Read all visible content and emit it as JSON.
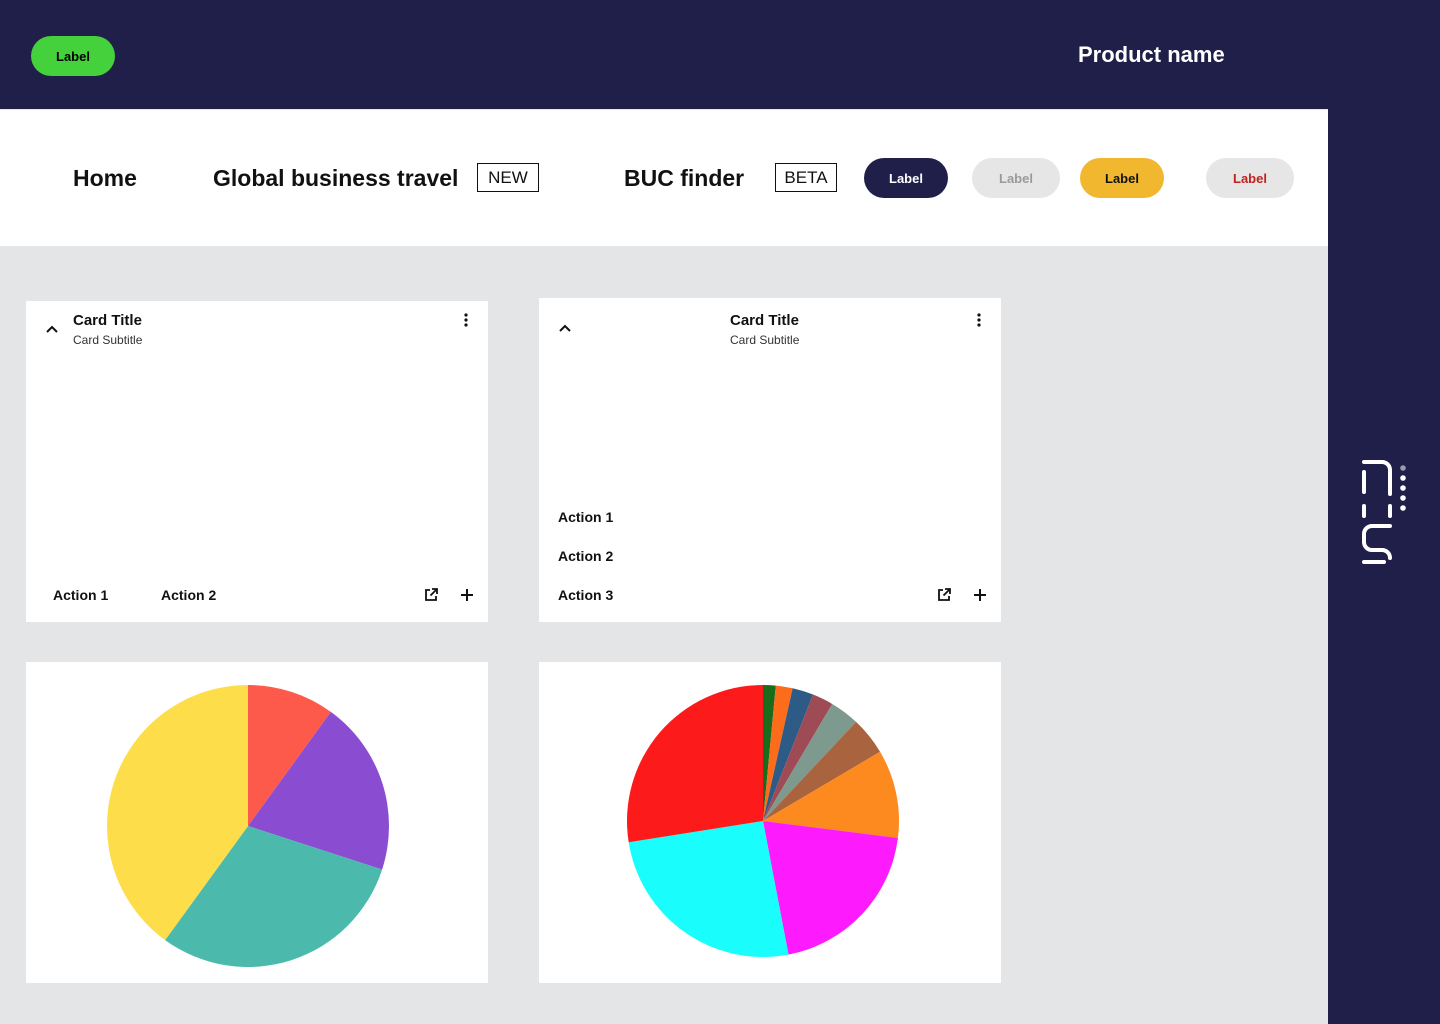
{
  "header": {
    "badge_label": "Label",
    "product_name": "Product name"
  },
  "nav": {
    "home": "Home",
    "global_business_travel": "Global business travel",
    "new_tag": "NEW",
    "buc_finder": "BUC finder",
    "beta_tag": "BETA",
    "pills": [
      {
        "label": "Label",
        "bg": "#1f1f4a",
        "fg": "#ffffff"
      },
      {
        "label": "Label",
        "bg": "#e6e6e6",
        "fg": "#9a9a9a"
      },
      {
        "label": "Label",
        "bg": "#f0b72f",
        "fg": "#111111"
      },
      {
        "label": "Label",
        "bg": "#e6e6e6",
        "fg": "#c0221e"
      }
    ]
  },
  "card1": {
    "title": "Card Title",
    "subtitle": "Card Subtitle",
    "actions": [
      "Action 1",
      "Action 2"
    ]
  },
  "card2": {
    "title": "Card Title",
    "subtitle": "Card Subtitle",
    "actions": [
      "Action 1",
      "Action 2",
      "Action 3"
    ]
  },
  "chart_data": [
    {
      "type": "pie",
      "values": [
        10,
        20,
        30,
        40
      ],
      "colors": [
        "#fd5a4c",
        "#8a4cd0",
        "#4bbaac",
        "#fdde4a"
      ]
    },
    {
      "type": "pie",
      "values": [
        1.5,
        2.0,
        2.5,
        2.5,
        3.5,
        4.5,
        10.5,
        20.0,
        25.5,
        27.5
      ],
      "colors": [
        "#1a6b1a",
        "#fc6c1a",
        "#2e5a86",
        "#9e4b55",
        "#7e9a8e",
        "#a9633e",
        "#fd8a1e",
        "#fd1afd",
        "#1afdfd",
        "#fd1a1a"
      ]
    }
  ]
}
